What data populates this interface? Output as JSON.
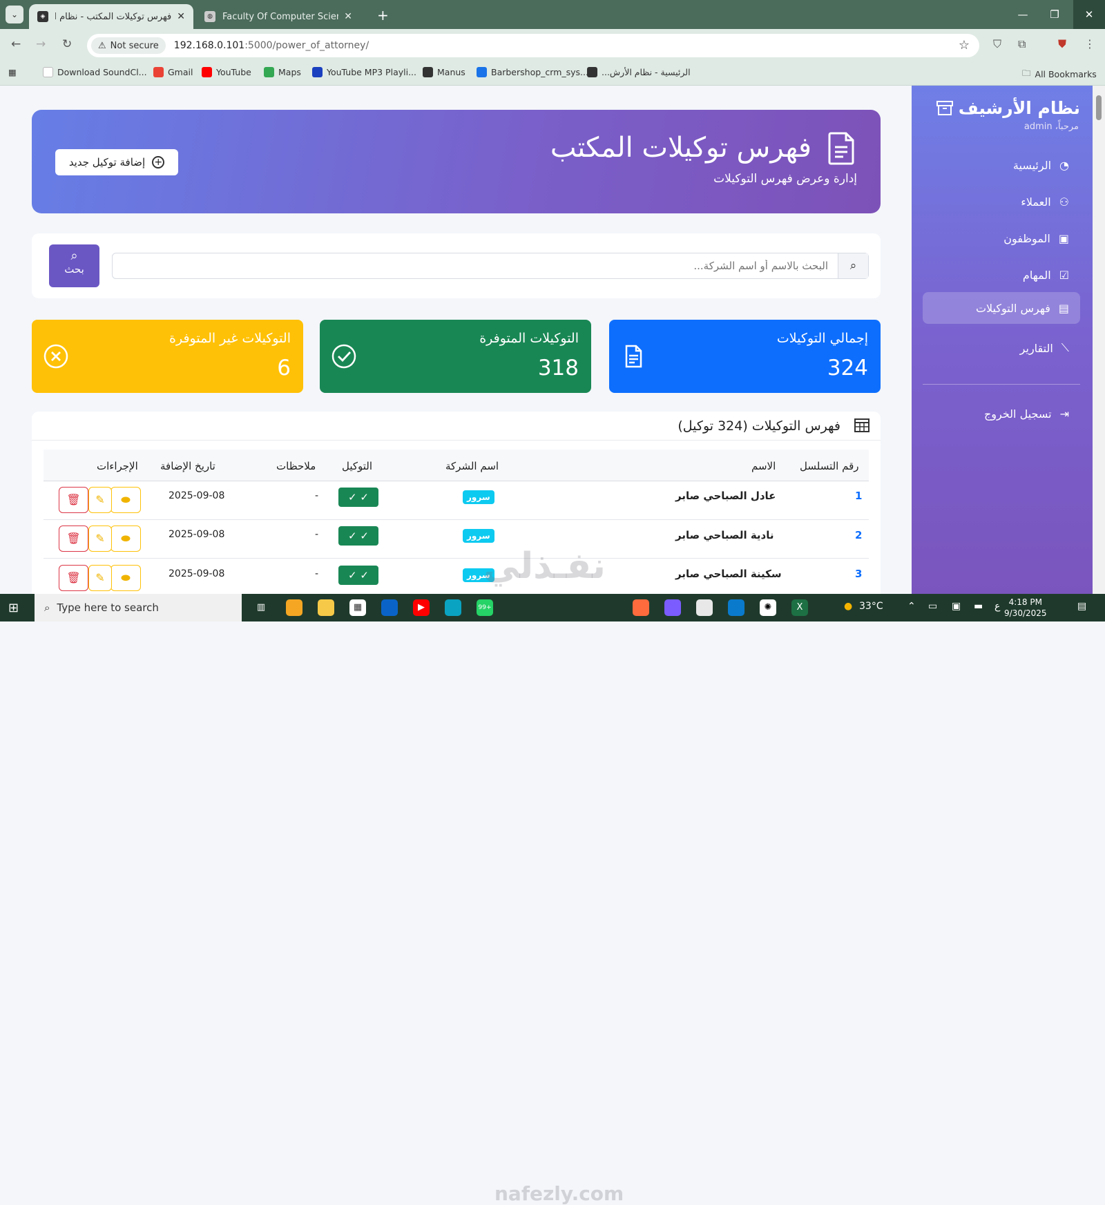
{
  "browser": {
    "tabs": [
      {
        "title": "فهرس توكيلات المكتب - نظام الأر",
        "icon": "nafezly-icon",
        "active": true
      },
      {
        "title": "Faculty Of Computer Science ar",
        "icon": "globe-icon",
        "active": false
      }
    ],
    "security_label": "Not secure",
    "url_host": "192.168.0.101",
    "url_path": ":5000/power_of_attorney/",
    "bookmarks": [
      {
        "label": "Download SoundCl...",
        "color": "#ffffff"
      },
      {
        "label": "Gmail",
        "color": "#ea4335"
      },
      {
        "label": "YouTube",
        "color": "#ff0000"
      },
      {
        "label": "Maps",
        "color": "#34a853"
      },
      {
        "label": "YouTube MP3 Playli...",
        "color": "#1a3fbf"
      },
      {
        "label": "Manus",
        "color": "#333333"
      },
      {
        "label": "Barbershop_crm_sys...",
        "color": "#1a73e8"
      },
      {
        "label": "الرئيسية - نظام الأرش...",
        "color": "#333333"
      }
    ],
    "all_bookmarks": "All Bookmarks"
  },
  "hero": {
    "title": "فهرس توكيلات المكتب",
    "subtitle": "إدارة وعرض فهرس التوكيلات",
    "add_button": "إضافة توكيل جديد"
  },
  "search": {
    "placeholder": "البحث بالاسم أو اسم الشركة...",
    "button": "بحث"
  },
  "stats": {
    "total_label": "إجمالي التوكيلات",
    "total_value": "324",
    "available_label": "التوكيلات المتوفرة",
    "available_value": "318",
    "unavailable_label": "التوكيلات غير المتوفرة",
    "unavailable_value": "6"
  },
  "table": {
    "title": "فهرس التوكيلات (324 توكيل)",
    "headers": {
      "serial": "رقم التسلسل",
      "name": "الاسم",
      "company": "اسم الشركة",
      "poa": "التوكيل",
      "notes": "ملاحظات",
      "date": "تاريخ الإضافة",
      "actions": "الإجراءات"
    },
    "rows": [
      {
        "serial": "1",
        "name": "عادل الصباحي صابر",
        "company": "سرور",
        "poa": "✓ ✓",
        "notes": "-",
        "date": "2025-09-08"
      },
      {
        "serial": "2",
        "name": "نادية الصباحي صابر",
        "company": "سرور",
        "poa": "✓ ✓",
        "notes": "-",
        "date": "2025-09-08"
      },
      {
        "serial": "3",
        "name": "سكينة الصباحي صابر",
        "company": "سرور",
        "poa": "✓ ✓",
        "notes": "-",
        "date": "2025-09-08"
      }
    ]
  },
  "sidebar": {
    "brand": "نظام الأرشيف",
    "welcome": "مرحباً، admin",
    "items": [
      {
        "label": "الرئيسية",
        "icon": "dashboard-icon"
      },
      {
        "label": "العملاء",
        "icon": "users-icon"
      },
      {
        "label": "الموظفون",
        "icon": "badge-icon"
      },
      {
        "label": "المهام",
        "icon": "checkbox-icon"
      },
      {
        "label": "فهرس التوكيلات",
        "icon": "document-icon"
      },
      {
        "label": "التقارير",
        "icon": "chart-icon"
      }
    ],
    "logout": "تسجيل الخروج"
  },
  "watermark": {
    "arabic": "نفـذلي",
    "latin": "nafezly.com"
  },
  "taskbar": {
    "search_placeholder": "Type here to search",
    "badge": "99+",
    "temperature": "33°C",
    "time": "4:18 PM",
    "date": "9/30/2025",
    "lang": "ع"
  },
  "colors": {
    "accent_purple": "#6b57c4",
    "stat_blue": "#0d6efd",
    "stat_green": "#198754",
    "stat_yellow": "#ffc107"
  }
}
